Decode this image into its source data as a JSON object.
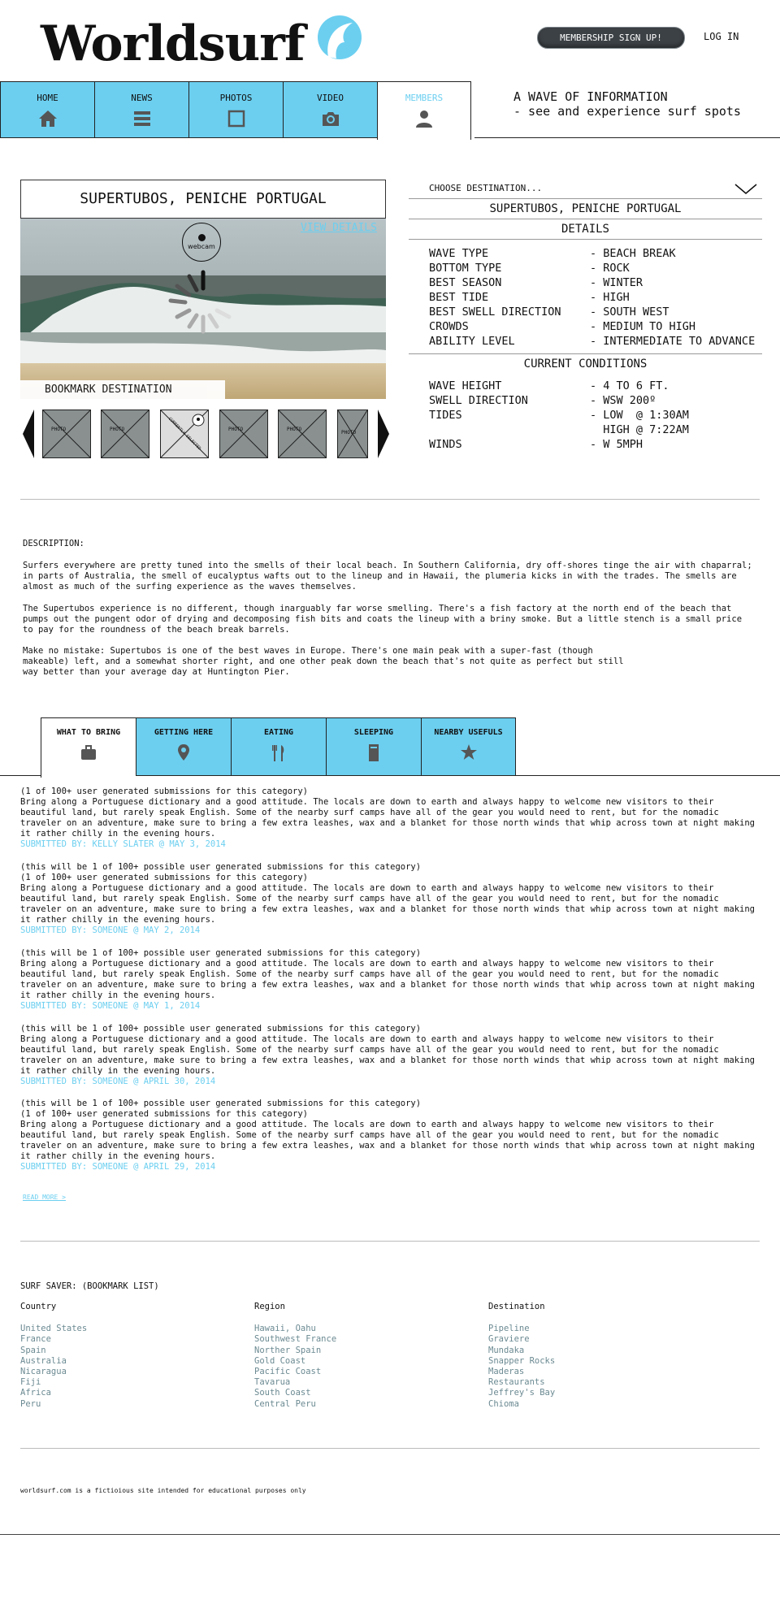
{
  "header": {
    "logo": "Worldsurf",
    "membership_button": "MEMBERSHIP SIGN UP!",
    "login": "LOG IN",
    "tagline_line1": "A WAVE OF INFORMATION",
    "tagline_line2": "- see and experience surf spots"
  },
  "nav": {
    "items": [
      {
        "label": "HOME",
        "icon": "home-icon"
      },
      {
        "label": "NEWS",
        "icon": "list-icon"
      },
      {
        "label": "PHOTOS",
        "icon": "photo-frame-icon"
      },
      {
        "label": "VIDEO",
        "icon": "camera-icon"
      },
      {
        "label": "MEMBERS",
        "icon": "user-icon",
        "active": true
      }
    ]
  },
  "spot": {
    "title": "SUPERTUBOS, PENICHE PORTUGAL",
    "view_details": "VIEW DETAILS",
    "webcam_label": "webcam",
    "bookmark": "BOOKMARK DESTINATION",
    "thumb_label": "PHOTO",
    "thumb_selected_label": "CURRENTLY SELECTED"
  },
  "destination": {
    "choose": "CHOOSE DESTINATION...",
    "selected": "SUPERTUBOS, PENICHE PORTUGAL",
    "details_heading": "DETAILS",
    "details": [
      {
        "k": "WAVE TYPE",
        "v": "- BEACH BREAK"
      },
      {
        "k": "BOTTOM TYPE",
        "v": "- ROCK"
      },
      {
        "k": "BEST SEASON",
        "v": "- WINTER"
      },
      {
        "k": "BEST TIDE",
        "v": "- HIGH"
      },
      {
        "k": "BEST SWELL DIRECTION",
        "v": "- SOUTH WEST"
      },
      {
        "k": "CROWDS",
        "v": "- MEDIUM TO HIGH"
      },
      {
        "k": "ABILITY LEVEL",
        "v": "- INTERMEDIATE TO ADVANCE"
      }
    ],
    "conditions_heading": "CURRENT CONDITIONS",
    "conditions": [
      {
        "k": "WAVE HEIGHT",
        "v": "- 4 TO 6 FT."
      },
      {
        "k": "SWELL DIRECTION",
        "v": "- WSW 200º"
      },
      {
        "k": "TIDES",
        "v": "- LOW  @ 1:30AM"
      },
      {
        "k": "",
        "v": "  HIGH @ 7:22AM"
      },
      {
        "k": "WINDS",
        "v": "- W 5MPH"
      }
    ]
  },
  "description": {
    "heading": "DESCRIPTION:",
    "p1": "Surfers everywhere are pretty tuned into the smells of their local beach. In Southern California, dry off-shores tinge the air with chaparral; in parts of Australia, the smell of eucalyptus wafts out to the lineup and in Hawaii, the plumeria kicks in with the trades. The smells are almost as much of the surfing experience as the waves themselves.",
    "p2": "The Supertubos experience is no different, though inarguably far worse smelling. There's a fish factory at the north end of the beach that pumps out the pungent odor of drying and decomposing fish bits and coats the lineup with a briny smoke. But a little stench is a small price to pay for the roundness of the beach break barrels.",
    "p3": "Make no mistake: Supertubos is one of the best waves in Europe. There's one main peak with a super-fast (though makeable) left, and a somewhat shorter right, and one other peak down the beach that's not quite as perfect but still way better than your average day at Huntington Pier."
  },
  "tabs": [
    {
      "label": "WHAT TO BRING",
      "icon": "briefcase-icon",
      "active": true
    },
    {
      "label": "GETTING HERE",
      "icon": "map-pin-icon"
    },
    {
      "label": "EATING",
      "icon": "fork-knife-icon"
    },
    {
      "label": "SLEEPING",
      "icon": "door-icon"
    },
    {
      "label": "NEARBY USEFULS",
      "icon": "star-icon"
    }
  ],
  "submissions": [
    {
      "lines": [
        "(1 of 100+ user generated submissions for this category)"
      ],
      "body": "Bring along a Portuguese dictionary and a good attitude. The locals are down to earth and always happy to welcome new visitors to their beautiful land, but rarely speak English. Some of the nearby surf camps have all of the gear you would need to rent, but for the nomadic traveler on an adventure, make sure to bring a few extra leashes, wax and a blanket for those north winds that whip across town at night making it rather chilly in the evening hours.",
      "by": "SUBMITTED BY: KELLY SLATER @ MAY 3, 2014"
    },
    {
      "lines": [
        "(this will be 1 of 100+ possible user generated submissions for this category)",
        "(1 of 100+ user generated submissions for this category)"
      ],
      "body": "Bring along a Portuguese dictionary and a good attitude. The locals are down to earth and always happy to welcome new visitors to their beautiful land, but rarely speak English. Some of the nearby surf camps have all of the gear you would need to rent, but for the nomadic traveler on an adventure, make sure to bring a few extra leashes, wax and a blanket for those north winds that whip across town at night making it rather chilly in the evening hours.",
      "by": "SUBMITTED BY: SOMEONE @ MAY 2, 2014"
    },
    {
      "lines": [
        "(this will be 1 of 100+ possible user generated submissions for this category)"
      ],
      "body": "Bring along a Portuguese dictionary and a good attitude. The locals are down to earth and always happy to welcome new visitors to their beautiful land, but rarely speak English. Some of the nearby surf camps have all of the gear you would need to rent, but for the nomadic traveler on an adventure, make sure to bring a few extra leashes, wax and a blanket for those north winds that whip across town at night making it rather chilly in the evening hours.",
      "by": "SUBMITTED BY: SOMEONE @ MAY 1, 2014"
    },
    {
      "lines": [
        "(this will be 1 of 100+ possible user generated submissions for this category)"
      ],
      "body": "Bring along a Portuguese dictionary and a good attitude. The locals are down to earth and always happy to welcome new visitors to their beautiful land, but rarely speak English. Some of the nearby surf camps have all of the gear you would need to rent, but for the nomadic traveler on an adventure, make sure to bring a few extra leashes, wax and a blanket for those north winds that whip across town at night making it rather chilly in the evening hours.",
      "by": "SUBMITTED BY: SOMEONE @ APRIL 30, 2014"
    },
    {
      "lines": [
        "(this will be 1 of 100+ possible user generated submissions for this category)",
        "(1 of 100+ user generated submissions for this category)"
      ],
      "body": "Bring along a Portuguese dictionary and a good attitude. The locals are down to earth and always happy to welcome new visitors to their beautiful land, but rarely speak English. Some of the nearby surf camps have all of the gear you would need to rent, but for the nomadic traveler on an adventure, make sure to bring a few extra leashes, wax and a blanket for those north winds that whip across town at night making it rather chilly in the evening hours.",
      "by": "SUBMITTED BY: SOMEONE @ APRIL 29, 2014"
    }
  ],
  "read_more": "READ MORE >",
  "bookmarks": {
    "title": "SURF SAVER: (BOOKMARK LIST)",
    "country_heading": "Country",
    "countries": [
      "United States",
      "France",
      "Spain",
      "Australia",
      "Nicaragua",
      "Fiji",
      "Africa",
      "Peru"
    ],
    "region_heading": "Region",
    "regions": [
      "Hawaii, Oahu",
      "Southwest France",
      "Norther Spain",
      "Gold Coast",
      "Pacific Coast",
      "Tavarua",
      "South Coast",
      "Central Peru"
    ],
    "destination_heading": "Destination",
    "destinations": [
      "Pipeline",
      "Graviere",
      "Mundaka",
      "Snapper Rocks",
      "Maderas",
      "Restaurants",
      "Jeffrey's Bay",
      "Chioma"
    ]
  },
  "footer": "worldsurf.com is a fictioious site intended for educational purposes only",
  "colors": {
    "accent": "#6ccff0",
    "link": "#6b8a92"
  }
}
